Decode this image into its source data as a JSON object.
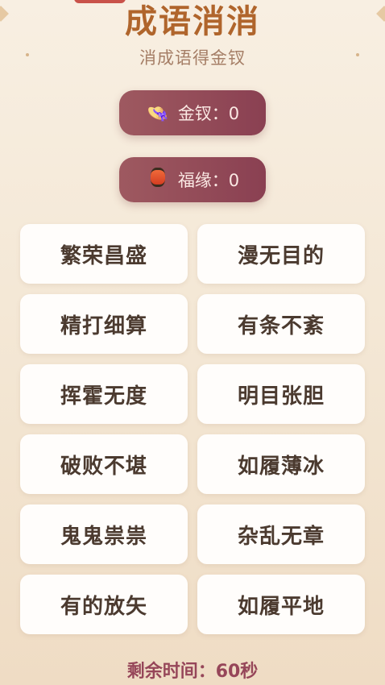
{
  "header": {
    "title": "成语消消",
    "subtitle": "消成语得金钗"
  },
  "stats": {
    "gold": {
      "icon": "hat-icon",
      "label": "金钗：0"
    },
    "luck": {
      "icon": "lantern-icon",
      "label": "福缘：0"
    }
  },
  "cards": [
    "繁荣昌盛",
    "漫无目的",
    "精打细算",
    "有条不紊",
    "挥霍无度",
    "明目张胆",
    "破败不堪",
    "如履薄冰",
    "鬼鬼祟祟",
    "杂乱无章",
    "有的放矢",
    "如履平地"
  ],
  "timer": {
    "label": "剩余时间：60秒"
  },
  "colors": {
    "title": "#b0652c",
    "stat_bg": "#8a4052",
    "card_bg": "#fffdfb",
    "timer": "#964659"
  }
}
